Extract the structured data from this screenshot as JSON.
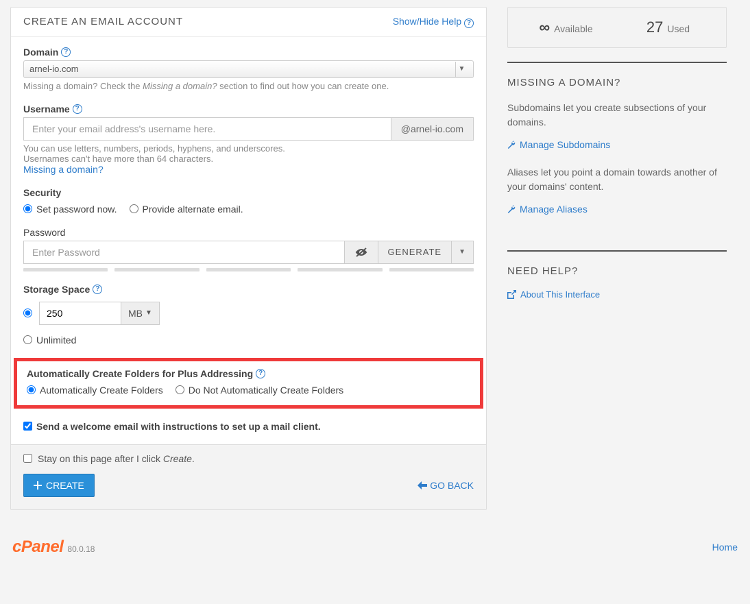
{
  "panel": {
    "title": "CREATE AN EMAIL ACCOUNT",
    "helpLink": "Show/Hide Help"
  },
  "domain": {
    "label": "Domain",
    "value": "arnel-io.com",
    "hintPrefix": "Missing a domain? Check the ",
    "hintItalic": "Missing a domain?",
    "hintSuffix": " section to find out how you can create one."
  },
  "username": {
    "label": "Username",
    "placeholder": "Enter your email address's username here.",
    "addon": "@arnel-io.com",
    "hint1": "You can use letters, numbers, periods, hyphens, and underscores.",
    "hint2": "Usernames can't have more than 64 characters.",
    "missingLink": "Missing a domain?"
  },
  "security": {
    "label": "Security",
    "opt1": "Set password now.",
    "opt2": "Provide alternate email."
  },
  "password": {
    "label": "Password",
    "placeholder": "Enter Password",
    "generateLabel": "GENERATE"
  },
  "storage": {
    "label": "Storage Space",
    "value": "250",
    "unit": "MB",
    "unlimited": "Unlimited"
  },
  "folders": {
    "label": "Automatically Create Folders for Plus Addressing",
    "opt1": "Automatically Create Folders",
    "opt2": "Do Not Automatically Create Folders"
  },
  "welcome": {
    "label": "Send a welcome email with instructions to set up a mail client."
  },
  "footer": {
    "stayPrefix": "Stay on this page after I click ",
    "stayItalic": "Create",
    "staySuffix": ".",
    "createBtn": "CREATE",
    "goBack": "GO BACK"
  },
  "stats": {
    "availableValue": "∞",
    "availableLabel": "Available",
    "usedValue": "27",
    "usedLabel": "Used"
  },
  "missingDomain": {
    "title": "MISSING A DOMAIN?",
    "subText": "Subdomains let you create subsections of your domains.",
    "subLink": "Manage Subdomains",
    "aliasText": "Aliases let you point a domain towards another of your domains' content.",
    "aliasLink": "Manage Aliases"
  },
  "needHelp": {
    "title": "NEED HELP?",
    "link": "About This Interface"
  },
  "brand": {
    "name": "cPanel",
    "version": "80.0.18",
    "home": "Home"
  }
}
